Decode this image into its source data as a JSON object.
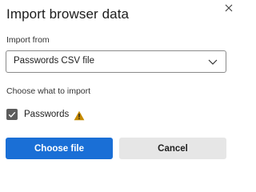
{
  "dialog": {
    "title": "Import browser data",
    "import_from": {
      "label": "Import from",
      "selected": "Passwords CSV file"
    },
    "choose": {
      "label": "Choose what to import",
      "items": [
        {
          "label": "Passwords",
          "checked": true,
          "warning": true
        }
      ]
    },
    "buttons": {
      "primary": "Choose file",
      "secondary": "Cancel"
    }
  },
  "colors": {
    "primary": "#1a6fd6",
    "secondary": "#e6e6e6",
    "checkbox": "#5c5c5c",
    "warning": "#c58a00"
  },
  "icons": [
    "close-icon",
    "chevron-down-icon",
    "checkmark-icon",
    "warning-icon"
  ]
}
